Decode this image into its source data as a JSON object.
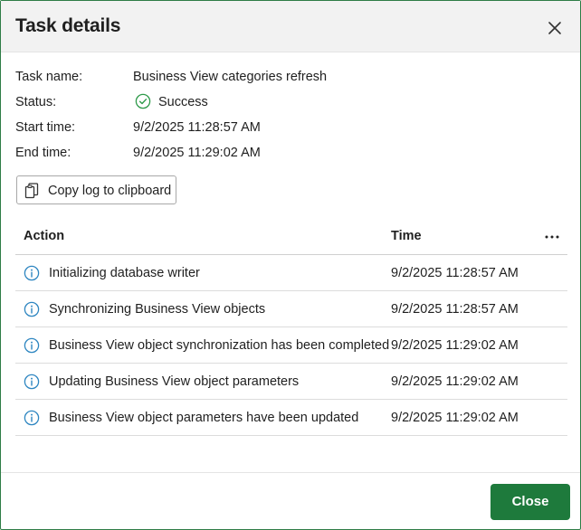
{
  "dialog": {
    "title": "Task details",
    "close_icon": "close-icon"
  },
  "details": {
    "task_name_label": "Task name:",
    "task_name_value": "Business View categories refresh",
    "status_label": "Status:",
    "status_value": "Success",
    "status_icon": "check-circle-icon",
    "start_time_label": "Start time:",
    "start_time_value": "9/2/2025 11:28:57 AM",
    "end_time_label": "End time:",
    "end_time_value": "9/2/2025 11:29:02 AM"
  },
  "copy_button": {
    "label": "Copy log to clipboard",
    "icon": "clipboard-icon"
  },
  "table": {
    "columns": [
      "Action",
      "Time"
    ],
    "more_icon": "more-horizontal-icon",
    "rows": [
      {
        "icon": "info-icon",
        "action": "Initializing database writer",
        "time": "9/2/2025 11:28:57 AM"
      },
      {
        "icon": "info-icon",
        "action": "Synchronizing Business View objects",
        "time": "9/2/2025 11:28:57 AM"
      },
      {
        "icon": "info-icon",
        "action": "Business View object synchronization has been completed",
        "time": "9/2/2025 11:29:02 AM"
      },
      {
        "icon": "info-icon",
        "action": "Updating Business View object parameters",
        "time": "9/2/2025 11:29:02 AM"
      },
      {
        "icon": "info-icon",
        "action": "Business View object parameters have been updated",
        "time": "9/2/2025 11:29:02 AM"
      }
    ]
  },
  "footer": {
    "close_label": "Close"
  },
  "colors": {
    "accent": "#1e7a3c",
    "success": "#2e9a4a",
    "info": "#2e86c1",
    "border": "#2e7d46"
  }
}
